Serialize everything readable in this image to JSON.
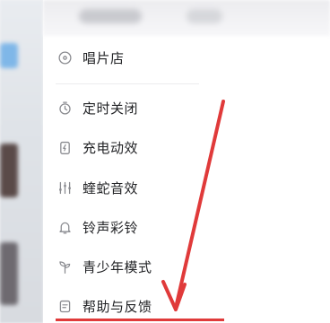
{
  "menu": {
    "items": [
      {
        "label": "唱片店",
        "icon": "disc-icon"
      },
      {
        "label": "定时关闭",
        "icon": "timer-icon"
      },
      {
        "label": "充电动效",
        "icon": "battery-charging-icon"
      },
      {
        "label": "蝰蛇音效",
        "icon": "equalizer-icon"
      },
      {
        "label": "铃声彩铃",
        "icon": "bell-icon"
      },
      {
        "label": "青少年模式",
        "icon": "sprout-icon"
      },
      {
        "label": "帮助与反馈",
        "icon": "feedback-icon"
      }
    ]
  },
  "colors": {
    "annotation": "#e03a3a",
    "icon": "#8a8b90",
    "text": "#222326"
  }
}
